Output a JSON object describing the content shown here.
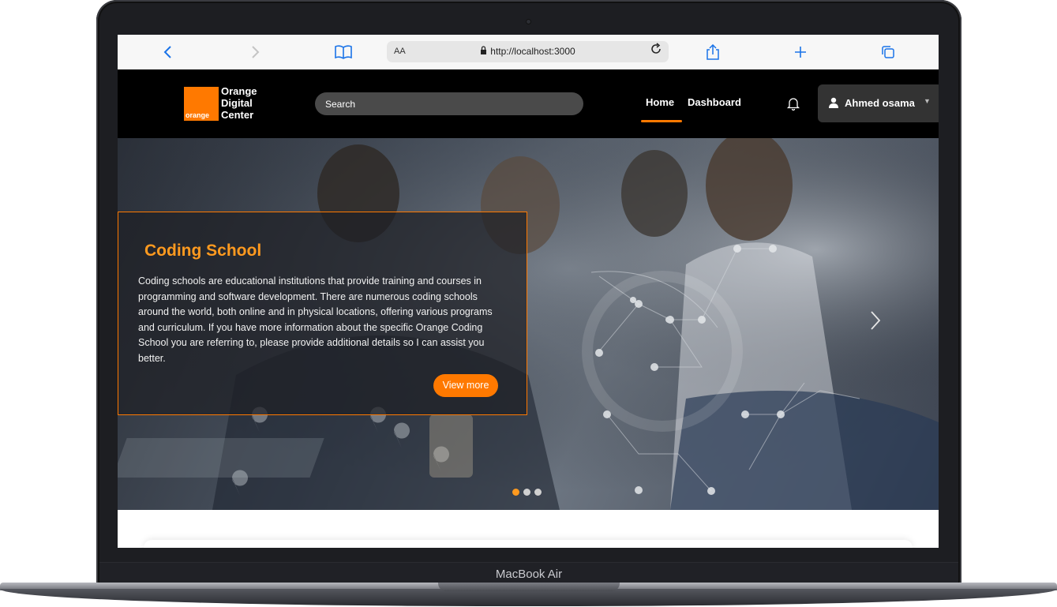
{
  "device": {
    "label": "MacBook Air"
  },
  "browser": {
    "back_icon": "chevron-left-icon",
    "forward_icon": "chevron-right-icon",
    "bookmarks_icon": "book-icon",
    "reader_label": "AA",
    "url": "http://localhost:3000",
    "reload_icon": "reload-icon",
    "share_icon": "share-icon",
    "new_tab_icon": "plus-icon",
    "tabs_icon": "tabs-icon",
    "accent_color": "#1a73e8"
  },
  "header": {
    "logo": {
      "box_text": "orange",
      "line1": "Orange",
      "line2": "Digital",
      "line3": "Center",
      "brand_color": "#ff7900"
    },
    "search_placeholder": "Search",
    "nav": [
      {
        "label": "Home",
        "active": true
      },
      {
        "label": "Dashboard",
        "active": false
      }
    ],
    "notification_icon": "bell-icon",
    "user": {
      "name": "Ahmed osama",
      "icon": "user-icon",
      "caret_icon": "caret-down-icon"
    }
  },
  "hero": {
    "title": "Coding School",
    "description": "Coding schools are educational institutions that provide training and courses in programming and software development. There are numerous coding schools around the world, both online and in physical locations, offering various programs and curriculum. If you have more information about the specific Orange Coding School you are referring to, please provide additional details so I can assist you better.",
    "cta_label": "View more",
    "next_icon": "chevron-right-icon",
    "slides": 3,
    "active_slide": 1,
    "accent_color": "#ff7900"
  }
}
